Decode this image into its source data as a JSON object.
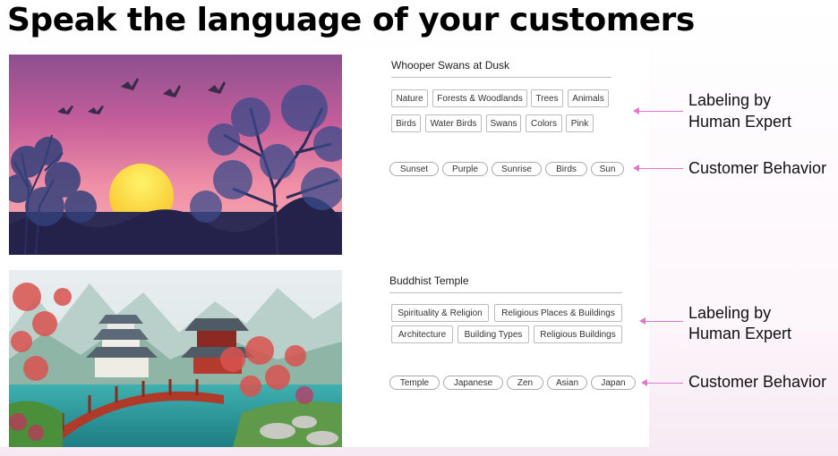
{
  "slide": {
    "title": "Speak the language of your customers"
  },
  "examples": [
    {
      "caption": "Whooper Swans at Dusk",
      "expert_tags_row1": [
        "Nature",
        "Forests & Woodlands",
        "Trees",
        "Animals"
      ],
      "expert_tags_row2": [
        "Birds",
        "Water Birds",
        "Swans",
        "Colors",
        "Pink"
      ],
      "customer_tags": [
        "Sunset",
        "Purple",
        "Sunrise",
        "Birds",
        "Sun"
      ],
      "expert_label": [
        "Labeling by",
        "Human Expert"
      ],
      "customer_label": "Customer Behavior"
    },
    {
      "caption": "Buddhist Temple",
      "expert_tags_row1": [
        "Spirituality & Religion",
        "Religious Places & Buildings"
      ],
      "expert_tags_row2": [
        "Architecture",
        "Building Types",
        "Religious Buildings"
      ],
      "customer_tags": [
        "Temple",
        "Japanese",
        "Zen",
        "Asian",
        "Japan"
      ],
      "expert_label": [
        "Labeling by",
        "Human Expert"
      ],
      "customer_label": "Customer Behavior"
    }
  ],
  "colors": {
    "arrow": "#e078c8",
    "tag_border": "#bcbcbc"
  }
}
